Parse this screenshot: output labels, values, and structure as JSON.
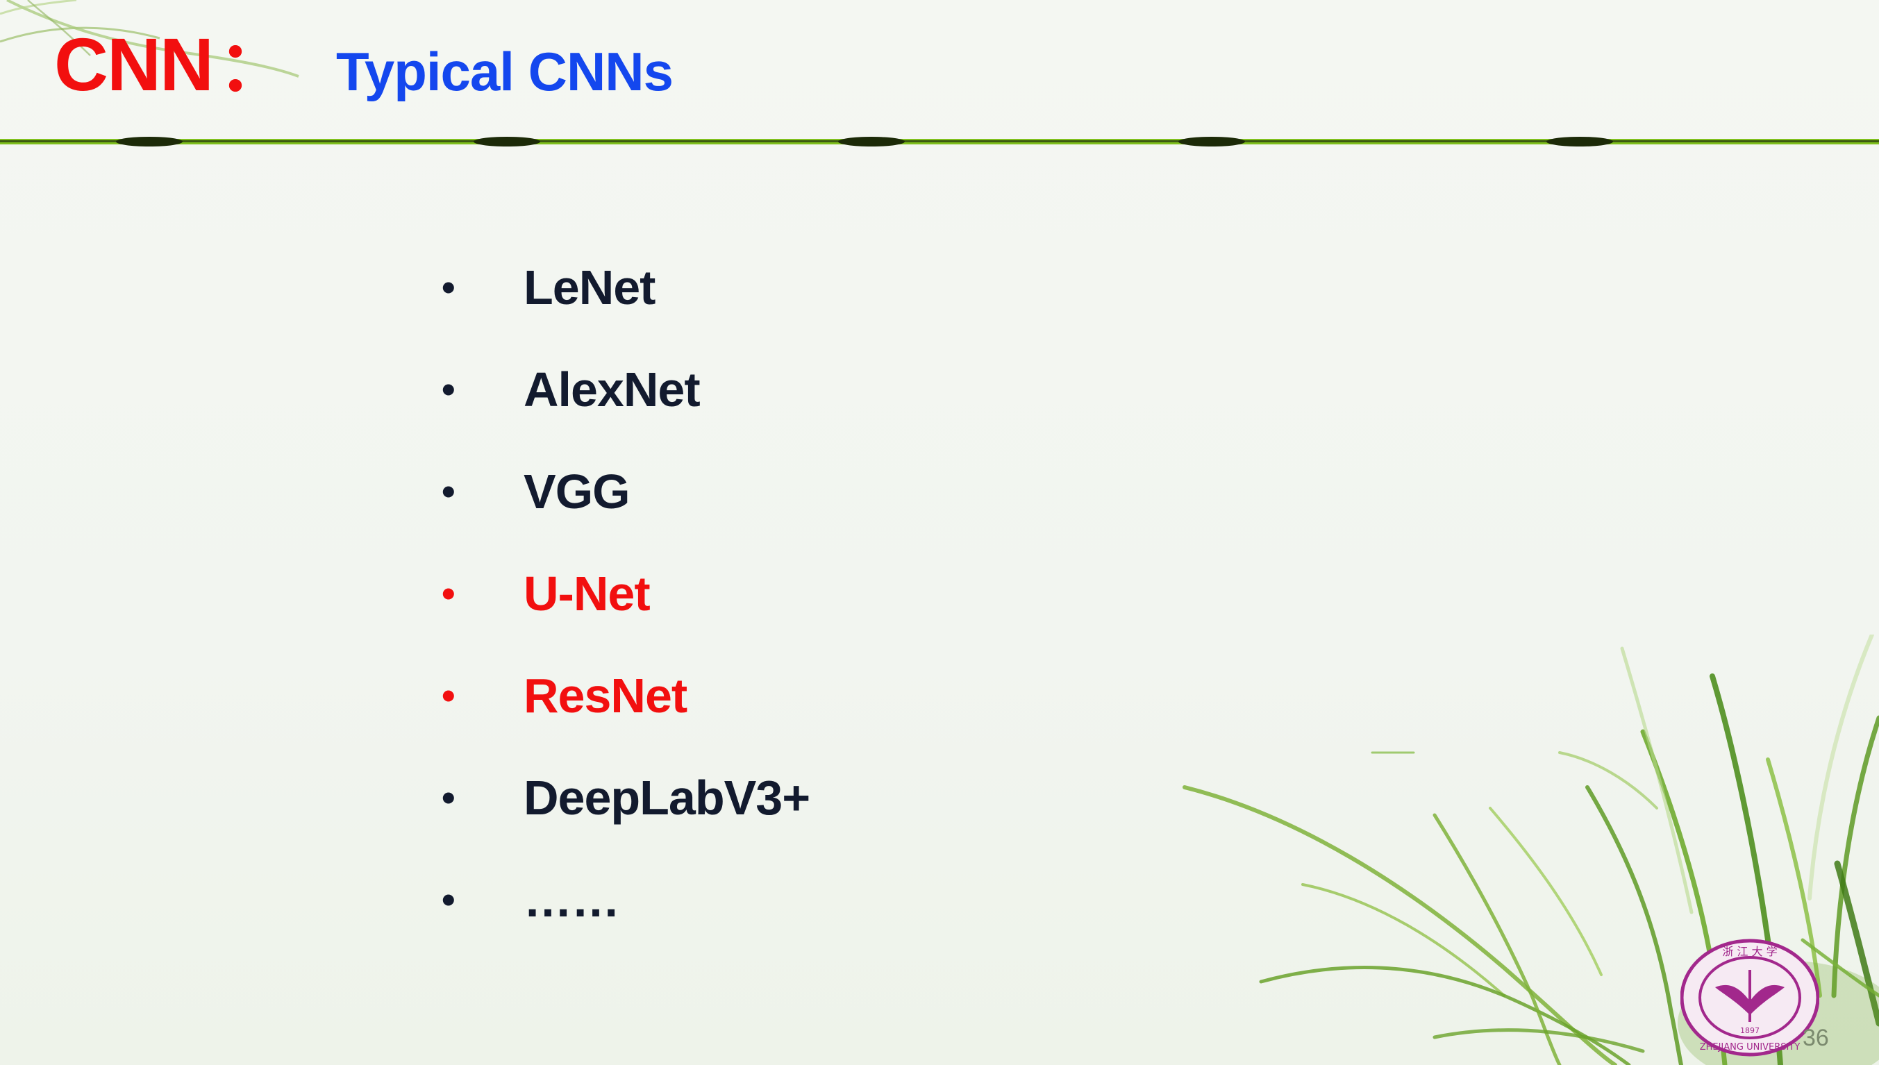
{
  "slide": {
    "title": "CNN",
    "title_separator": "：",
    "subtitle": "Typical CNNs",
    "bullets": [
      {
        "label": "LeNet",
        "highlight": false
      },
      {
        "label": "AlexNet",
        "highlight": false
      },
      {
        "label": "VGG",
        "highlight": false
      },
      {
        "label": "U-Net",
        "highlight": true
      },
      {
        "label": "ResNet",
        "highlight": true
      },
      {
        "label": "DeepLabV3+",
        "highlight": false
      },
      {
        "label": "……",
        "highlight": false
      }
    ],
    "bullet_symbol": "•",
    "page_number": "36"
  },
  "logo": {
    "icon": "university-seal-icon",
    "text": "ZHEJIANG UNIVERSITY",
    "year": "1897"
  },
  "colors": {
    "title": "#f20f0f",
    "subtitle": "#1447ee",
    "body_text": "#121a2e",
    "highlight": "#f20f0f",
    "divider": "#7fc01d",
    "logo": "#a2288c"
  }
}
